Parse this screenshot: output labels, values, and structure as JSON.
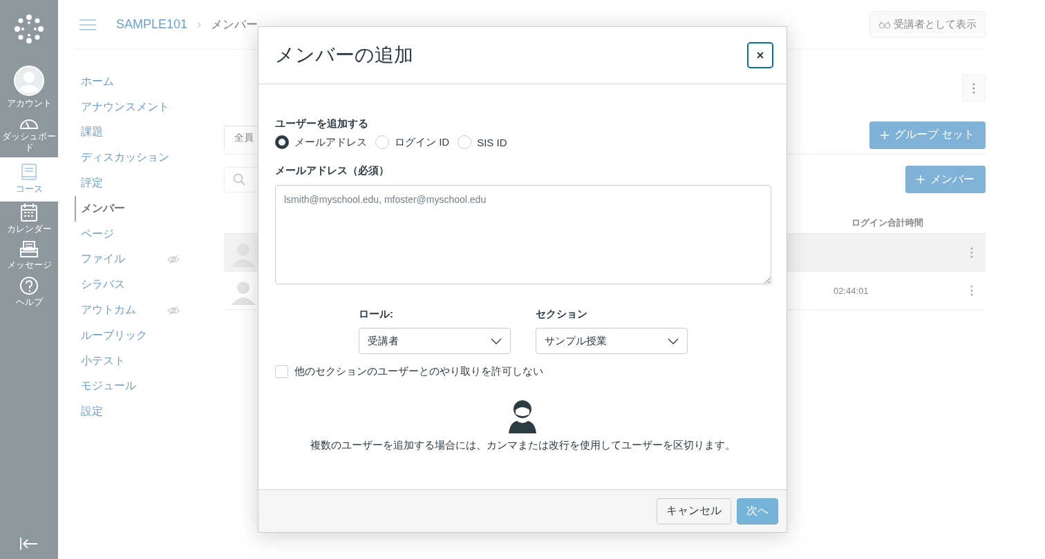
{
  "global_nav": [
    {
      "label": "アカウント",
      "kind": "account",
      "selected": false
    },
    {
      "label": "ダッシュボード",
      "kind": "dashboard",
      "selected": false
    },
    {
      "label": "コース",
      "kind": "courses",
      "selected": true
    },
    {
      "label": "カレンダー",
      "kind": "calendar",
      "selected": false
    },
    {
      "label": "メッセージ",
      "kind": "inbox",
      "selected": false
    },
    {
      "label": "ヘルプ",
      "kind": "help",
      "selected": false
    }
  ],
  "breadcrumb": {
    "course": "SAMPLE101",
    "page": "メンバー"
  },
  "student_view_button": "受講者として表示",
  "course_nav": [
    {
      "label": "ホーム",
      "selected": false,
      "hidden": false
    },
    {
      "label": "アナウンスメント",
      "selected": false,
      "hidden": false
    },
    {
      "label": "課題",
      "selected": false,
      "hidden": false
    },
    {
      "label": "ディスカッション",
      "selected": false,
      "hidden": false
    },
    {
      "label": "評定",
      "selected": false,
      "hidden": false
    },
    {
      "label": "メンバー",
      "selected": true,
      "hidden": false
    },
    {
      "label": "ページ",
      "selected": false,
      "hidden": false
    },
    {
      "label": "ファイル",
      "selected": false,
      "hidden": true
    },
    {
      "label": "シラバス",
      "selected": false,
      "hidden": false
    },
    {
      "label": "アウトカム",
      "selected": false,
      "hidden": true
    },
    {
      "label": "ルーブリック",
      "selected": false,
      "hidden": false
    },
    {
      "label": "小テスト",
      "selected": false,
      "hidden": false
    },
    {
      "label": "モジュール",
      "selected": false,
      "hidden": false
    },
    {
      "label": "設定",
      "selected": false,
      "hidden": false
    }
  ],
  "tabs": [
    {
      "label": "全員",
      "selected": true
    }
  ],
  "group_set_button": "グループ セット",
  "add_member_button": "メンバー",
  "table": {
    "columns": [
      "ログイン合計時間"
    ],
    "rows": [
      {
        "highlighted": true
      },
      {
        "highlighted": false,
        "total_time": "02:44:01"
      }
    ]
  },
  "dialog": {
    "title": "メンバーの追加",
    "add_by": {
      "label": "ユーザーを追加する",
      "options": [
        {
          "label": "メールアドレス",
          "selected": true
        },
        {
          "label": "ログイン ID",
          "selected": false
        },
        {
          "label": "SIS ID",
          "selected": false
        }
      ]
    },
    "field": {
      "label": "メールアドレス（必須）",
      "placeholder": "lsmith@myschool.edu, mfoster@myschool.edu"
    },
    "role": {
      "label": "ロール:",
      "value": "受講者"
    },
    "section": {
      "label": "セクション",
      "value": "サンプル授業"
    },
    "limit_checkbox": {
      "label": "他のセクションのユーザーとのやり取りを許可しない",
      "checked": false
    },
    "hint": "複数のユーザーを追加する場合には、カンマまたは改行を使用してユーザーを区切ります。",
    "buttons": [
      {
        "label": "キャンセル",
        "kind": "secondary"
      },
      {
        "label": "次へ",
        "kind": "primary"
      }
    ]
  }
}
